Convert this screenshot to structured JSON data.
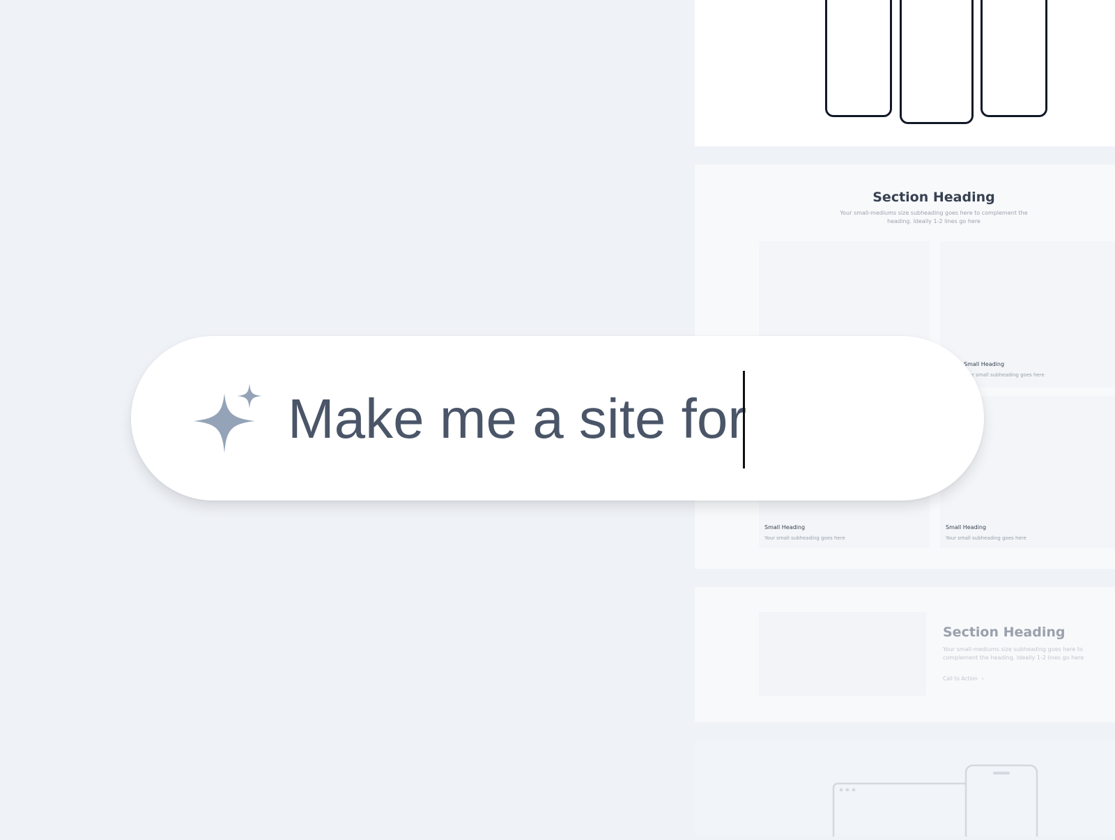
{
  "prompt": {
    "text": "Make me a site for",
    "icon": "sparkle-icon"
  },
  "wireframes": {
    "features": {
      "heading": "Section Heading",
      "subheading_line1": "Your small-mediums size subheading goes here to complement the",
      "subheading_line2": "heading. Ideally 1-2 lines go here",
      "cards": [
        {
          "title": "",
          "subtitle": ""
        },
        {
          "title": "Small Heading",
          "subtitle": "Your small subheading goes here"
        },
        {
          "title": "Small Heading",
          "subtitle": "Your small subheading goes here"
        },
        {
          "title": "Small Heading",
          "subtitle": "Your small subheading goes here"
        }
      ]
    },
    "split": {
      "heading": "Section Heading",
      "subheading": "Your small-mediums size subheading goes here to complement the heading. Ideally 1-2 lines go here",
      "cta_label": "Call to Action",
      "cta_icon": "chevron-right-icon"
    }
  },
  "colors": {
    "background": "#eff2f7",
    "prompt_text": "#4a5568",
    "sparkle": "#94a3b8",
    "caret": "#111111"
  }
}
